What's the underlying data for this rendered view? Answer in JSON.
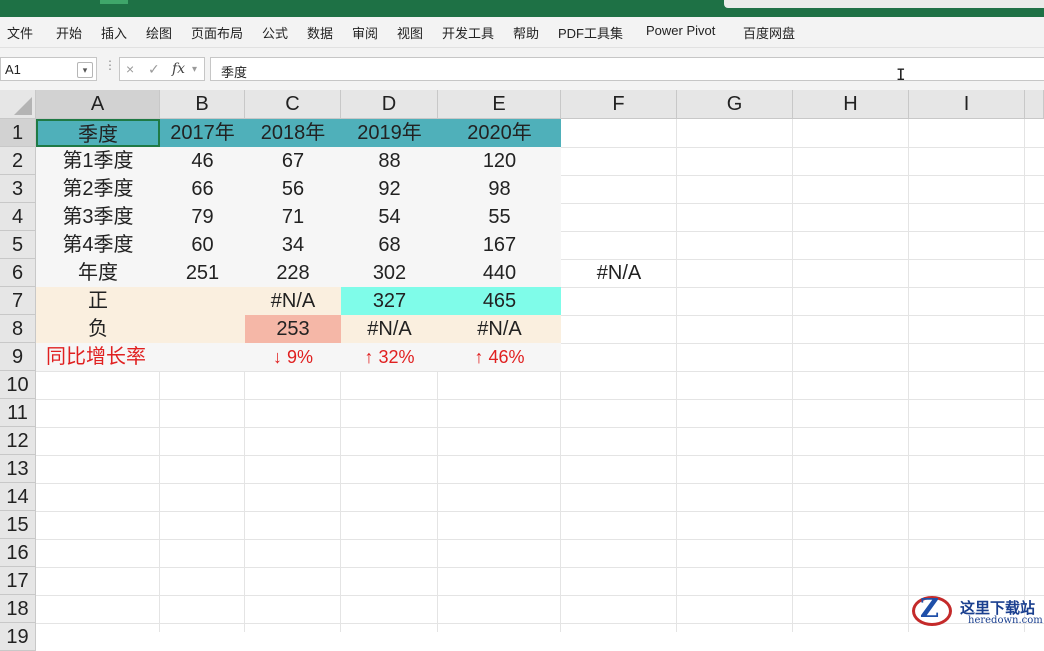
{
  "menu": [
    "文件",
    "开始",
    "插入",
    "绘图",
    "页面布局",
    "公式",
    "数据",
    "审阅",
    "视图",
    "开发工具",
    "帮助",
    "PDF工具集",
    "Power Pivot",
    "百度网盘"
  ],
  "name_box": "A1",
  "formula_icons": {
    "cancel": "×",
    "enter": "✓",
    "fx": "fx"
  },
  "formula_value": "季度",
  "columns": [
    "A",
    "B",
    "C",
    "D",
    "E",
    "F",
    "G",
    "H",
    "I"
  ],
  "rows": [
    "1",
    "2",
    "3",
    "4",
    "5",
    "6",
    "7",
    "8",
    "9",
    "10",
    "11",
    "12",
    "13",
    "14",
    "15",
    "16",
    "17",
    "18",
    "19"
  ],
  "sheet": {
    "r1": [
      "季度",
      "2017年",
      "2018年",
      "2019年",
      "2020年"
    ],
    "r2": [
      "第1季度",
      "46",
      "67",
      "88",
      "120"
    ],
    "r3": [
      "第2季度",
      "66",
      "56",
      "92",
      "98"
    ],
    "r4": [
      "第3季度",
      "79",
      "71",
      "54",
      "55"
    ],
    "r5": [
      "第4季度",
      "60",
      "34",
      "68",
      "167"
    ],
    "r6": [
      "年度",
      "251",
      "228",
      "302",
      "440"
    ],
    "r6_f": "#N/A",
    "r7": [
      "正",
      "",
      "#N/A",
      "327",
      "465"
    ],
    "r8": [
      "负",
      "",
      "253",
      "#N/A",
      "#N/A"
    ],
    "r9": [
      "同比增长率",
      "",
      "↓ 9%",
      "↑ 32%",
      "↑ 46%"
    ]
  },
  "colors": {
    "header_fill": "#4fb0ba",
    "positive_fill": "#7ffce9",
    "negative_fill": "#f5b7a7",
    "highlight_fill": "#faefdf",
    "growth_text": "#e02020",
    "title_bar": "#1e7145"
  },
  "watermark": {
    "cn": "这里下载站",
    "en": "heredown.com"
  }
}
